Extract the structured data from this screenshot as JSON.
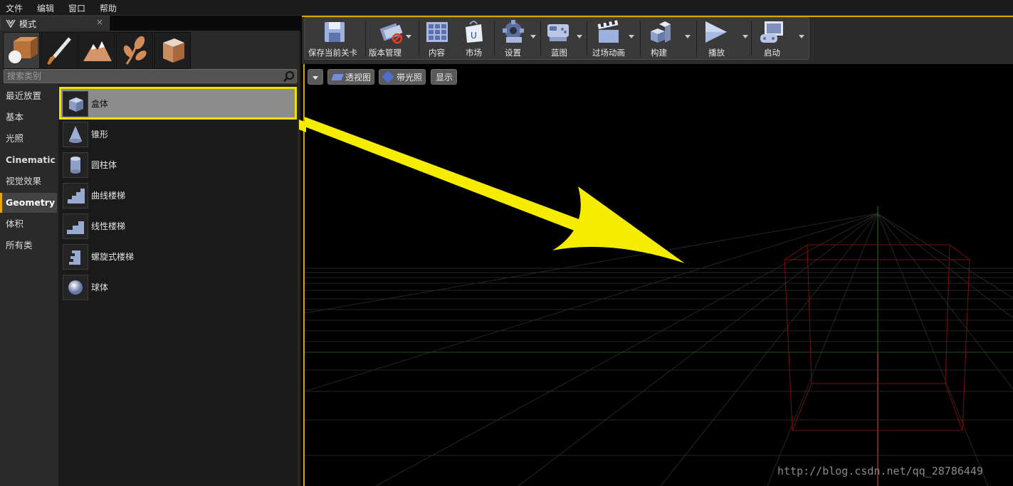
{
  "menu": [
    "文件",
    "编辑",
    "窗口",
    "帮助"
  ],
  "modes_panel": {
    "tab_title": "模式",
    "close_glyph": "×",
    "mode_tabs": [
      "place-mode-icon",
      "paint-mode-icon",
      "landscape-mode-icon",
      "foliage-mode-icon",
      "geometry-edit-mode-icon"
    ],
    "search_placeholder": "搜索类别",
    "categories": [
      "最近放置",
      "基本",
      "光照",
      "Cinematic",
      "视觉效果",
      "Geometry",
      "体积",
      "所有类"
    ],
    "selected_category": "Geometry",
    "items": [
      {
        "label": "盒体",
        "icon": "box-icon"
      },
      {
        "label": "锥形",
        "icon": "cone-icon"
      },
      {
        "label": "圆柱体",
        "icon": "cylinder-icon"
      },
      {
        "label": "曲线楼梯",
        "icon": "curved-stair-icon"
      },
      {
        "label": "线性楼梯",
        "icon": "linear-stair-icon"
      },
      {
        "label": "螺旋式楼梯",
        "icon": "spiral-stair-icon"
      },
      {
        "label": "球体",
        "icon": "sphere-icon"
      }
    ],
    "selected_item": "盒体"
  },
  "toolbar": {
    "buttons": [
      {
        "label": "保存当前关卡",
        "icon": "save-icon"
      },
      {
        "label": "版本管理",
        "icon": "source-control-icon"
      },
      {
        "label": "内容",
        "icon": "content-icon"
      },
      {
        "label": "市场",
        "icon": "marketplace-icon"
      },
      {
        "label": "设置",
        "icon": "settings-icon"
      },
      {
        "label": "蓝图",
        "icon": "blueprint-icon"
      },
      {
        "label": "过场动画",
        "icon": "cinematics-icon"
      },
      {
        "label": "构建",
        "icon": "build-icon"
      },
      {
        "label": "播放",
        "icon": "play-icon"
      },
      {
        "label": "启动",
        "icon": "launch-icon"
      }
    ]
  },
  "viewport": {
    "perspective_label": "透视图",
    "lit_label": "带光照",
    "show_label": "显示"
  },
  "watermark": "http://blog.csdn.net/qq_28786449",
  "colors": {
    "highlight": "#f2e000",
    "accent": "#d9a400",
    "arrow": "#f5ec00",
    "box_wire": "#7a0f0f"
  }
}
